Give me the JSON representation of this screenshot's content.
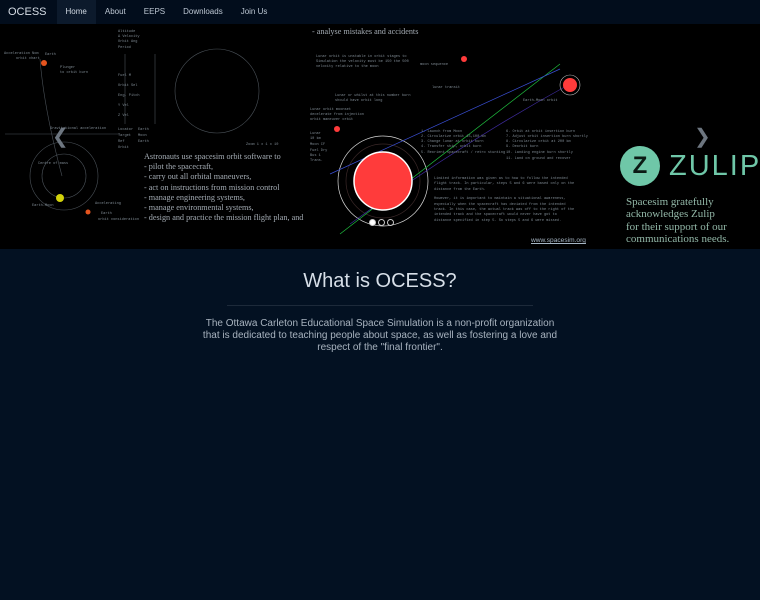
{
  "nav": {
    "brand": "OCESS",
    "items": [
      {
        "label": "Home",
        "active": true
      },
      {
        "label": "About"
      },
      {
        "label": "EEPS"
      },
      {
        "label": "Downloads"
      },
      {
        "label": "Join Us"
      }
    ]
  },
  "carousel": {
    "slide": {
      "analyse_line": "- analyse mistakes and accidents",
      "caption_intro": "Astronauts use spacesim orbit software to",
      "caption_items": [
        "- pilot the spacecraft,",
        "- carry out all orbital maneuvers,",
        "- act on instructions from mission control",
        "- manage engineering systems,",
        "- manage environmental systems,",
        "- design and practice the mission flight plan, and"
      ],
      "url": "www.spacesim.org"
    },
    "next_slide": {
      "logo_letter": "Z",
      "logo_word": "ZULIP",
      "ack_lines": [
        "Spacesim gratefully",
        "acknowledges Zulip",
        "for their support of our",
        "communications needs."
      ]
    },
    "prev_icon": "chevron-left",
    "next_icon": "chevron-right",
    "indicator_count": 3,
    "active_indicator": 0,
    "colors": {
      "planet": "#ff3b3b",
      "orbit_green": "#1fbf3f",
      "orbit_blue": "#3a4fd6",
      "zulip": "#6fc7a8"
    }
  },
  "main": {
    "title": "What is OCESS?",
    "intro": "The Ottawa Carleton Educational Space Simulation is a non-profit organization that is dedicated to teaching people about space, as well as fostering a love and respect of the \"final frontier\"."
  },
  "colors": {
    "background": "#031122",
    "navbar": "#020d1c",
    "nav_active": "#0c1a2c"
  }
}
